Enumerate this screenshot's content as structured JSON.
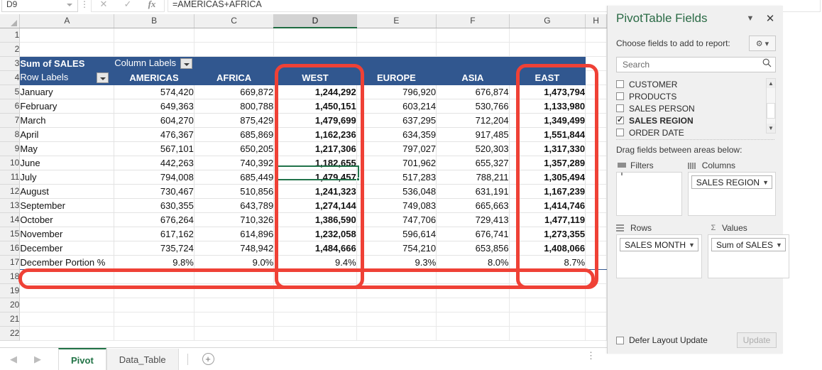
{
  "formula_bar": {
    "name_box": "D9",
    "formula": "=AMERICAS+AFRICA",
    "cancel_icon": "close-icon",
    "enter_icon": "check-icon",
    "fx_label": "fx"
  },
  "grid": {
    "column_headers": [
      "A",
      "B",
      "C",
      "D",
      "E",
      "F",
      "G",
      "H"
    ],
    "selected_column": "D",
    "row_numbers": [
      "1",
      "2",
      "3",
      "4",
      "5",
      "6",
      "7",
      "8",
      "9",
      "10",
      "11",
      "12",
      "13",
      "14",
      "15",
      "16",
      "17",
      "18",
      "19",
      "20",
      "21",
      "22"
    ],
    "pivot": {
      "title": "Sum of SALES",
      "column_labels": "Column Labels",
      "row_labels": "Row Labels",
      "region_headers": [
        "AMERICAS",
        "AFRICA",
        "WEST",
        "EUROPE",
        "ASIA",
        "EAST"
      ],
      "rows": [
        {
          "month": "January",
          "values": [
            "574,420",
            "669,872",
            "1,244,292",
            "796,920",
            "676,874",
            "1,473,794"
          ]
        },
        {
          "month": "February",
          "values": [
            "649,363",
            "800,788",
            "1,450,151",
            "603,214",
            "530,766",
            "1,133,980"
          ]
        },
        {
          "month": "March",
          "values": [
            "604,270",
            "875,429",
            "1,479,699",
            "637,295",
            "712,204",
            "1,349,499"
          ]
        },
        {
          "month": "April",
          "values": [
            "476,367",
            "685,869",
            "1,162,236",
            "634,359",
            "917,485",
            "1,551,844"
          ]
        },
        {
          "month": "May",
          "values": [
            "567,101",
            "650,205",
            "1,217,306",
            "797,027",
            "520,303",
            "1,317,330"
          ]
        },
        {
          "month": "June",
          "values": [
            "442,263",
            "740,392",
            "1,182,655",
            "701,962",
            "655,327",
            "1,357,289"
          ]
        },
        {
          "month": "July",
          "values": [
            "794,008",
            "685,449",
            "1,479,457",
            "517,283",
            "788,211",
            "1,305,494"
          ]
        },
        {
          "month": "August",
          "values": [
            "730,467",
            "510,856",
            "1,241,323",
            "536,048",
            "631,191",
            "1,167,239"
          ]
        },
        {
          "month": "September",
          "values": [
            "630,355",
            "643,789",
            "1,274,144",
            "749,083",
            "665,663",
            "1,414,746"
          ]
        },
        {
          "month": "October",
          "values": [
            "676,264",
            "710,326",
            "1,386,590",
            "747,706",
            "729,413",
            "1,477,119"
          ]
        },
        {
          "month": "November",
          "values": [
            "617,162",
            "614,896",
            "1,232,058",
            "596,614",
            "676,741",
            "1,273,355"
          ]
        },
        {
          "month": "December",
          "values": [
            "735,724",
            "748,942",
            "1,484,666",
            "754,210",
            "653,856",
            "1,408,066"
          ]
        }
      ],
      "total_row": {
        "label": "December Portion %",
        "values": [
          "9.8%",
          "9.0%",
          "9.4%",
          "9.3%",
          "8.0%",
          "8.7%"
        ]
      }
    },
    "selected_cell": "D9"
  },
  "sheet_tabs": {
    "prev_icon": "chevron-left-icon",
    "next_icon": "chevron-right-icon",
    "tabs": [
      {
        "label": "Pivot",
        "active": true
      },
      {
        "label": "Data_Table",
        "active": false
      }
    ],
    "add_sheet_icon": "plus-circle-icon"
  },
  "pivot_pane": {
    "title": "PivotTable Fields",
    "collapse_icon": "chevron-down-icon",
    "close_icon": "close-icon",
    "choose_label": "Choose fields to add to report:",
    "gear_icon": "gear-icon",
    "gear_caret_icon": "chevron-down-icon",
    "search": {
      "placeholder": "Search",
      "value": "",
      "icon": "search-icon"
    },
    "fields": [
      {
        "name": "CUSTOMER",
        "checked": false
      },
      {
        "name": "PRODUCTS",
        "checked": false
      },
      {
        "name": "SALES PERSON",
        "checked": false
      },
      {
        "name": "SALES REGION",
        "checked": true
      },
      {
        "name": "ORDER DATE",
        "checked": false
      }
    ],
    "drag_label": "Drag fields between areas below:",
    "areas": [
      {
        "name": "Filters",
        "icon": "filter-icon",
        "items": []
      },
      {
        "name": "Columns",
        "icon": "columns-icon",
        "items": [
          "SALES REGION"
        ]
      },
      {
        "name": "Rows",
        "icon": "rows-icon",
        "items": [
          "SALES MONTH"
        ]
      },
      {
        "name": "Values",
        "icon": "sigma-icon",
        "items": [
          "Sum of SALES"
        ]
      }
    ],
    "defer_label": "Defer Layout Update",
    "defer_checked": false,
    "update_label": "Update"
  },
  "colors": {
    "pivot_header_blue": "#31578f",
    "annotation_red": "#ef4136",
    "excel_green": "#217346",
    "selection_green": "#21734a"
  }
}
